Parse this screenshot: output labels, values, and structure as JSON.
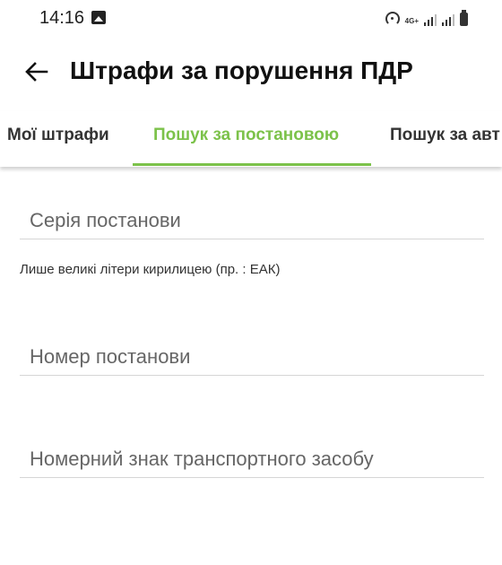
{
  "status_bar": {
    "time": "14:16",
    "network_label": "4G+",
    "icons": [
      "photo-icon",
      "hotspot-icon",
      "signal-icon",
      "signal-icon",
      "battery-icon"
    ]
  },
  "app_bar": {
    "title": "Штрафи за порушення ПДР"
  },
  "tabs": [
    {
      "label": "Мої штрафи",
      "active": false
    },
    {
      "label": "Пошук за постановою",
      "active": true
    },
    {
      "label": "Пошук за авт",
      "active": false
    }
  ],
  "form": {
    "series": {
      "placeholder": "Серія постанови",
      "value": ""
    },
    "series_hint": "Лише великі літери кирилицею (пр. : ЕАК)",
    "number": {
      "placeholder": "Номер постанови",
      "value": ""
    },
    "plate": {
      "placeholder": "Номерний знак транспортного засобу",
      "value": ""
    }
  },
  "colors": {
    "accent": "#7cc24a",
    "text": "#111111",
    "placeholder": "#666666"
  }
}
